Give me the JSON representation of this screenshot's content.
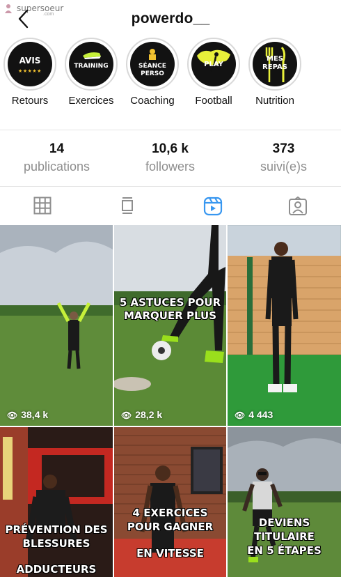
{
  "watermark": {
    "text": "supersoeur",
    "sub": ".com"
  },
  "header": {
    "username": "powerdo__"
  },
  "highlights": [
    {
      "badge": "AVIS",
      "stars": "★★★★★",
      "label": "Retours"
    },
    {
      "badge": "TRAINING",
      "label": "Exercices"
    },
    {
      "badge_line1": "SÉANCE",
      "badge_line2": "PERSO",
      "label": "Coaching"
    },
    {
      "badge": "PLAY",
      "label": "Football"
    },
    {
      "badge_line1": "MES",
      "badge_line2": "REPAS",
      "label": "Nutrition"
    }
  ],
  "stats": [
    {
      "value": "14",
      "label": "publications"
    },
    {
      "value": "10,6 k",
      "label": "followers"
    },
    {
      "value": "373",
      "label": "suivi(e)s"
    }
  ],
  "tabs": [
    {
      "name": "grid",
      "icon": "grid-icon",
      "active": false
    },
    {
      "name": "guides",
      "icon": "guide-icon",
      "active": false
    },
    {
      "name": "reels",
      "icon": "reels-icon",
      "active": true
    },
    {
      "name": "tagged",
      "icon": "tagged-icon",
      "active": false
    }
  ],
  "colors": {
    "accent": "#3897f0",
    "muted": "#8e8e8e",
    "divider": "#e4e4e4"
  },
  "posts": [
    {
      "views": "38,4 k"
    },
    {
      "views": "28,2 k",
      "caption_line1": "5 ASTUCES POUR",
      "caption_line2": "MARQUER PLUS"
    },
    {
      "views": "4 443"
    },
    {
      "caption_line1": "PRÉVENTION DES",
      "caption_line2": "BLESSURES",
      "caption_line3": "ADDUCTEURS"
    },
    {
      "caption_line1": "4 EXERCICES",
      "caption_line2": "POUR GAGNER",
      "caption_line3": "EN VITESSE"
    },
    {
      "caption_line1": "DEVIENS",
      "caption_line2": "TITULAIRE",
      "caption_line3": "EN 5 ÉTAPES"
    }
  ]
}
